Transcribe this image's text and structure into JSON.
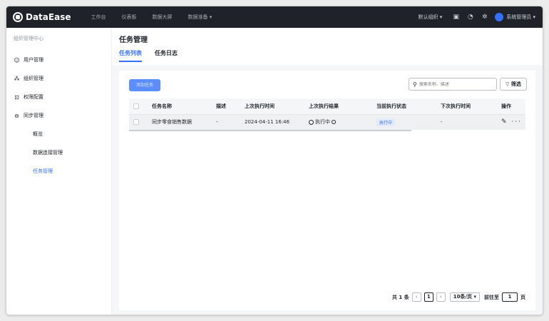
{
  "app": {
    "name": "DataEase"
  },
  "topnav": {
    "items": [
      "工作台",
      "仪表板",
      "数据大屏",
      "数据准备 ▾"
    ],
    "org": "默认组织 ▾",
    "user": "系统管理员 ▾"
  },
  "sidebar": {
    "header": "组织管理中心",
    "items": [
      {
        "label": "用户管理",
        "icon": "user-icon"
      },
      {
        "label": "组织管理",
        "icon": "org-icon"
      },
      {
        "label": "权限配置",
        "icon": "lock-icon"
      },
      {
        "label": "同步管理",
        "icon": "sync-icon"
      }
    ],
    "subitems": [
      "概览",
      "数据连接管理",
      "任务管理"
    ]
  },
  "main": {
    "title": "任务管理",
    "tabs": [
      "任务列表",
      "任务日志"
    ],
    "add_button": "添加任务",
    "search_placeholder": "搜索名称、描述",
    "filter_label": "▽ 筛选",
    "columns": [
      "任务名称",
      "描述",
      "上次执行时间",
      "上次执行结果",
      "当前执行状态",
      "下次执行时间",
      "操作"
    ],
    "rows": [
      {
        "name": "同步零食销售数据",
        "desc": "-",
        "last_time": "2024-04-11  16:46",
        "last_result": "执行中",
        "status": "执行中",
        "next_time": "-",
        "ops": "✎ ···"
      }
    ]
  },
  "pager": {
    "total": "共 1 条",
    "prev": "‹",
    "current": "1",
    "next": "›",
    "page_size": "10条/页 ▾",
    "goto_label": "前往至",
    "goto_value": "1",
    "goto_suffix": "页"
  }
}
